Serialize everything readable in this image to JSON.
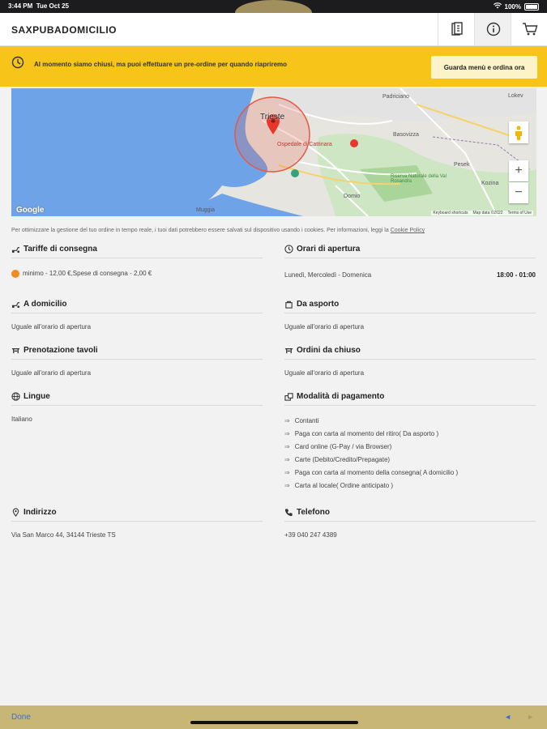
{
  "status": {
    "time": "3:44 PM",
    "date": "Tue Oct 25",
    "battery": "100%"
  },
  "header": {
    "title": "SAXPUBADOMICILIO"
  },
  "banner": {
    "message": "Al momento siamo chiusi, ma puoi effettuare un pre-ordine per quando riapriremo",
    "button": "Guarda menù e ordina ora"
  },
  "map": {
    "labels": {
      "trieste": "Trieste",
      "ospedale": "Ospedale di Cattinara",
      "padriciano": "Padriciano",
      "basovizza": "Basovizza",
      "pesek": "Pesek",
      "domio": "Domio",
      "porto": "Riserva Naturale della Val Rosandra",
      "lokev": "Lokev",
      "kozina": "Kozina",
      "muggia": "Muggia"
    },
    "zoom_in": "+",
    "zoom_out": "−",
    "keyboard": "Keyboard shortcuts",
    "mapdata": "Map data ©2022",
    "terms": "Terms of Use",
    "google": "Google"
  },
  "privacy": {
    "text": "Per ottimizzare la gestione del tuo ordine in tempo reale, i tuoi dati potrebbero essere salvati sul dispositivo usando i cookies. Per informazioni, leggi la",
    "link": "Cookie Policy"
  },
  "sections": {
    "tariffe": {
      "title": "Tariffe di consegna",
      "text": "minimo - 12,00 €,Spese di consegna - 2,00 €"
    },
    "orari": {
      "title": "Orari di apertura",
      "days": "Lunedì, Mercoledì - Domenica",
      "hours": "18:00 - 01:00"
    },
    "domicilio": {
      "title": "A domicilio",
      "text": "Uguale all'orario di apertura"
    },
    "asporto": {
      "title": "Da asporto",
      "text": "Uguale all'orario di apertura"
    },
    "prenotazione": {
      "title": "Prenotazione tavoli",
      "text": "Uguale all'orario di apertura"
    },
    "chiuso": {
      "title": "Ordini da chiuso",
      "text": "Uguale all'orario di apertura"
    },
    "lingue": {
      "title": "Lingue",
      "text": "Italiano"
    },
    "pagamento": {
      "title": "Modalità di pagamento",
      "items": [
        "Contanti",
        "Paga con carta al momento del ritiro( Da asporto )",
        "Card online (G-Pay / via Browser)",
        "Carte (Debito/Credito/Prepagate)",
        "Paga con carta al momento della consegna( A domicilio )",
        "Carta al locale( Ordine anticipato )"
      ]
    },
    "indirizzo": {
      "title": "Indirizzo",
      "text": "Via San Marco 44, 34144 Trieste TS"
    },
    "telefono": {
      "title": "Telefono",
      "text": "+39 040 247 4389"
    }
  },
  "bottom": {
    "done": "Done",
    "prev": "◄",
    "next": "►"
  }
}
